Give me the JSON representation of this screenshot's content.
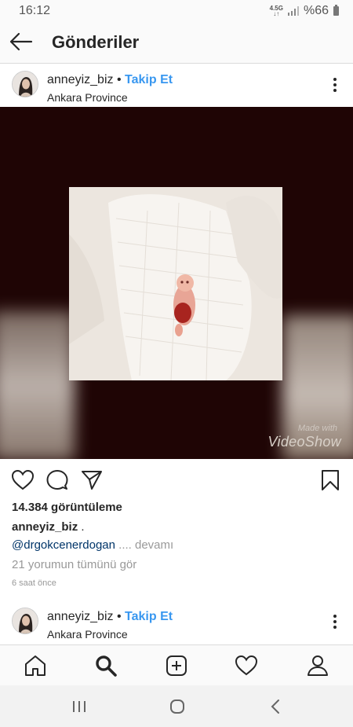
{
  "status": {
    "time": "16:12",
    "network": "4.5G",
    "battery": "%66"
  },
  "appbar": {
    "title": "Gönderiler",
    "back_icon": "arrow-left-icon"
  },
  "post": {
    "username": "anneyiz_biz",
    "separator": "•",
    "follow_label": "Takip Et",
    "location": "Ankara Province",
    "watermark_top": "Made with",
    "watermark_brand": "VideoShow",
    "views": "14.384 görüntüleme",
    "caption_user": "anneyiz_biz",
    "caption_text": " .",
    "mention": "@drgokcenerdogan",
    "more_label": " .... devamı",
    "comments_link": "21 yorumun tümünü gör",
    "time_ago": "6 saat önce"
  },
  "next_post": {
    "username": "anneyiz_biz",
    "separator": "•",
    "follow_label": "Takip Et",
    "location": "Ankara Province"
  },
  "icons": {
    "like": "heart-icon",
    "comment": "comment-icon",
    "share": "send-icon",
    "save": "bookmark-icon",
    "home": "home-icon",
    "search": "search-icon",
    "add": "add-post-icon",
    "activity": "heart-icon",
    "profile": "profile-icon"
  },
  "colors": {
    "link_blue": "#3897f0",
    "mention": "#003569",
    "media_bg": "#1f0505"
  }
}
